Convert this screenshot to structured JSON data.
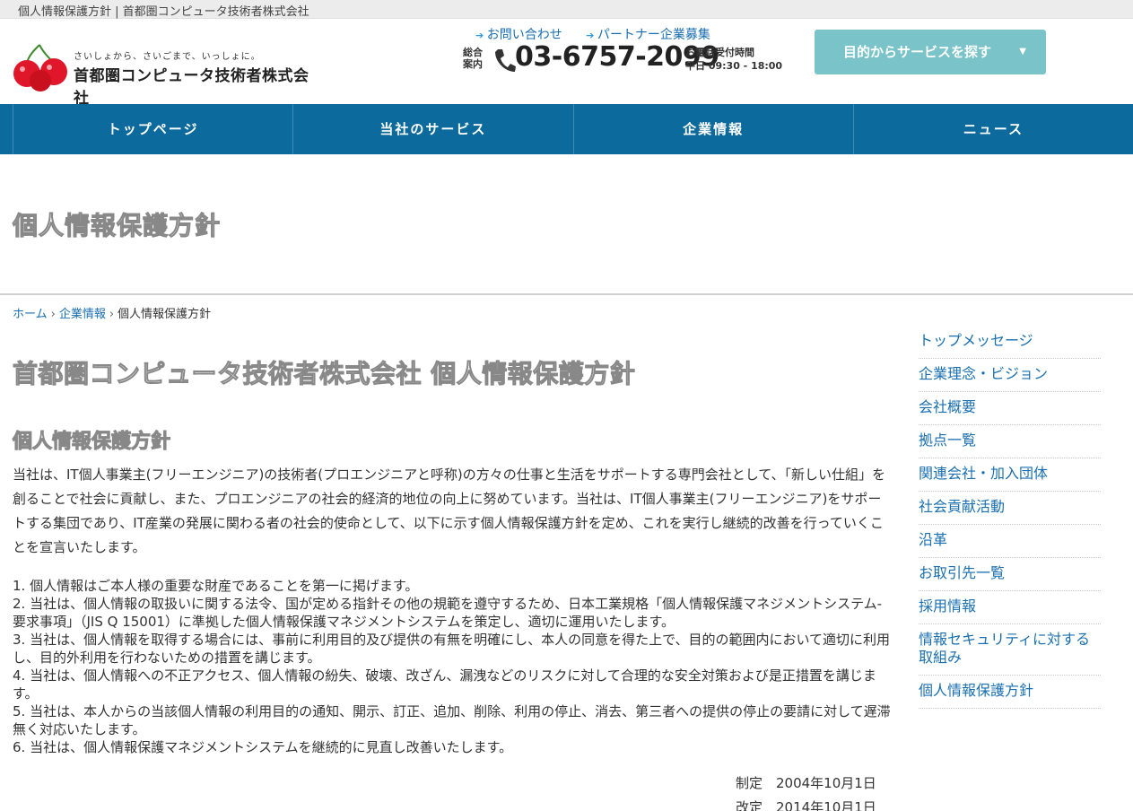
{
  "topbar": {
    "text": "個人情報保護方針 | 首都圏コンピュータ技術者株式会社"
  },
  "logo": {
    "tagline": "さいしょから、さいごまで、いっしょに。",
    "company": "首都圏コンピュータ技術者株式会社"
  },
  "toplinks": {
    "contact": "お問い合わせ",
    "partner": "パートナー企業募集"
  },
  "phone": {
    "label": "総合案内",
    "number": "03-6757-2099",
    "hours_title": "お電話受付時間",
    "hours": "平日 09:30 - 18:00"
  },
  "service_button": {
    "label": "目的からサービスを探す"
  },
  "nav": {
    "items": [
      "トップページ",
      "当社のサービス",
      "企業情報",
      "ニュース"
    ]
  },
  "page_title": "個人情報保護方針",
  "breadcrumb": {
    "home": "ホーム",
    "parent": "企業情報",
    "current": "個人情報保護方針",
    "sep": "›"
  },
  "main": {
    "heading": "首都圏コンピュータ技術者株式会社 個人情報保護方針",
    "subheading": "個人情報保護方針",
    "intro": "当社は、IT個人事業主(フリーエンジニア)の技術者(プロエンジニアと呼称)の方々の仕事と生活をサポートする専門会社として、「新しい仕組」を創ることで社会に貢献し、また、プロエンジニアの社会的経済的地位の向上に努めています。当社は、IT個人事業主(フリーエンジニア)をサポートする集団であり、IT産業の発展に関わる者の社会的使命として、以下に示す個人情報保護方針を定め、これを実行し継続的改善を行っていくことを宣言いたします。",
    "items": [
      "1. 個人情報はご本人様の重要な財産であることを第一に掲げます。",
      "2. 当社は、個人情報の取扱いに関する法令、国が定める指針その他の規範を遵守するため、日本工業規格「個人情報保護マネジメントシステム-要求事項」（JIS Q 15001）に準拠した個人情報保護マネジメントシステムを策定し、適切に運用いたします。",
      "3. 当社は、個人情報を取得する場合には、事前に利用目的及び提供の有無を明確にし、本人の同意を得た上で、目的の範囲内において適切に利用し、目的外利用を行わないための措置を講じます。",
      "4. 当社は、個人情報への不正アクセス、個人情報の紛失、破壊、改ざん、漏洩などのリスクに対して合理的な安全対策および是正措置を講じます。",
      "5. 当社は、本人からの当該個人情報の利用目的の通知、開示、訂正、追加、削除、利用の停止、消去、第三者への提供の停止の要請に対して遅滞無く対応いたします。",
      "6. 当社は、個人情報保護マネジメントシステムを継続的に見直し改善いたします。"
    ],
    "established": "制定　2004年10月1日",
    "revised": "改定　2014年10月1日"
  },
  "sidebar": {
    "items": [
      "トップメッセージ",
      "企業理念・ビジョン",
      "会社概要",
      "拠点一覧",
      "関連会社・加入団体",
      "社会貢献活動",
      "沿革",
      "お取引先一覧",
      "採用情報",
      "情報セキュリティに対する取組み",
      "個人情報保護方針"
    ]
  },
  "colors": {
    "nav": "#0c6a9c",
    "accent_button": "#7ac4c9",
    "link": "#1a6fb0",
    "logo_red": "#e0162b"
  }
}
